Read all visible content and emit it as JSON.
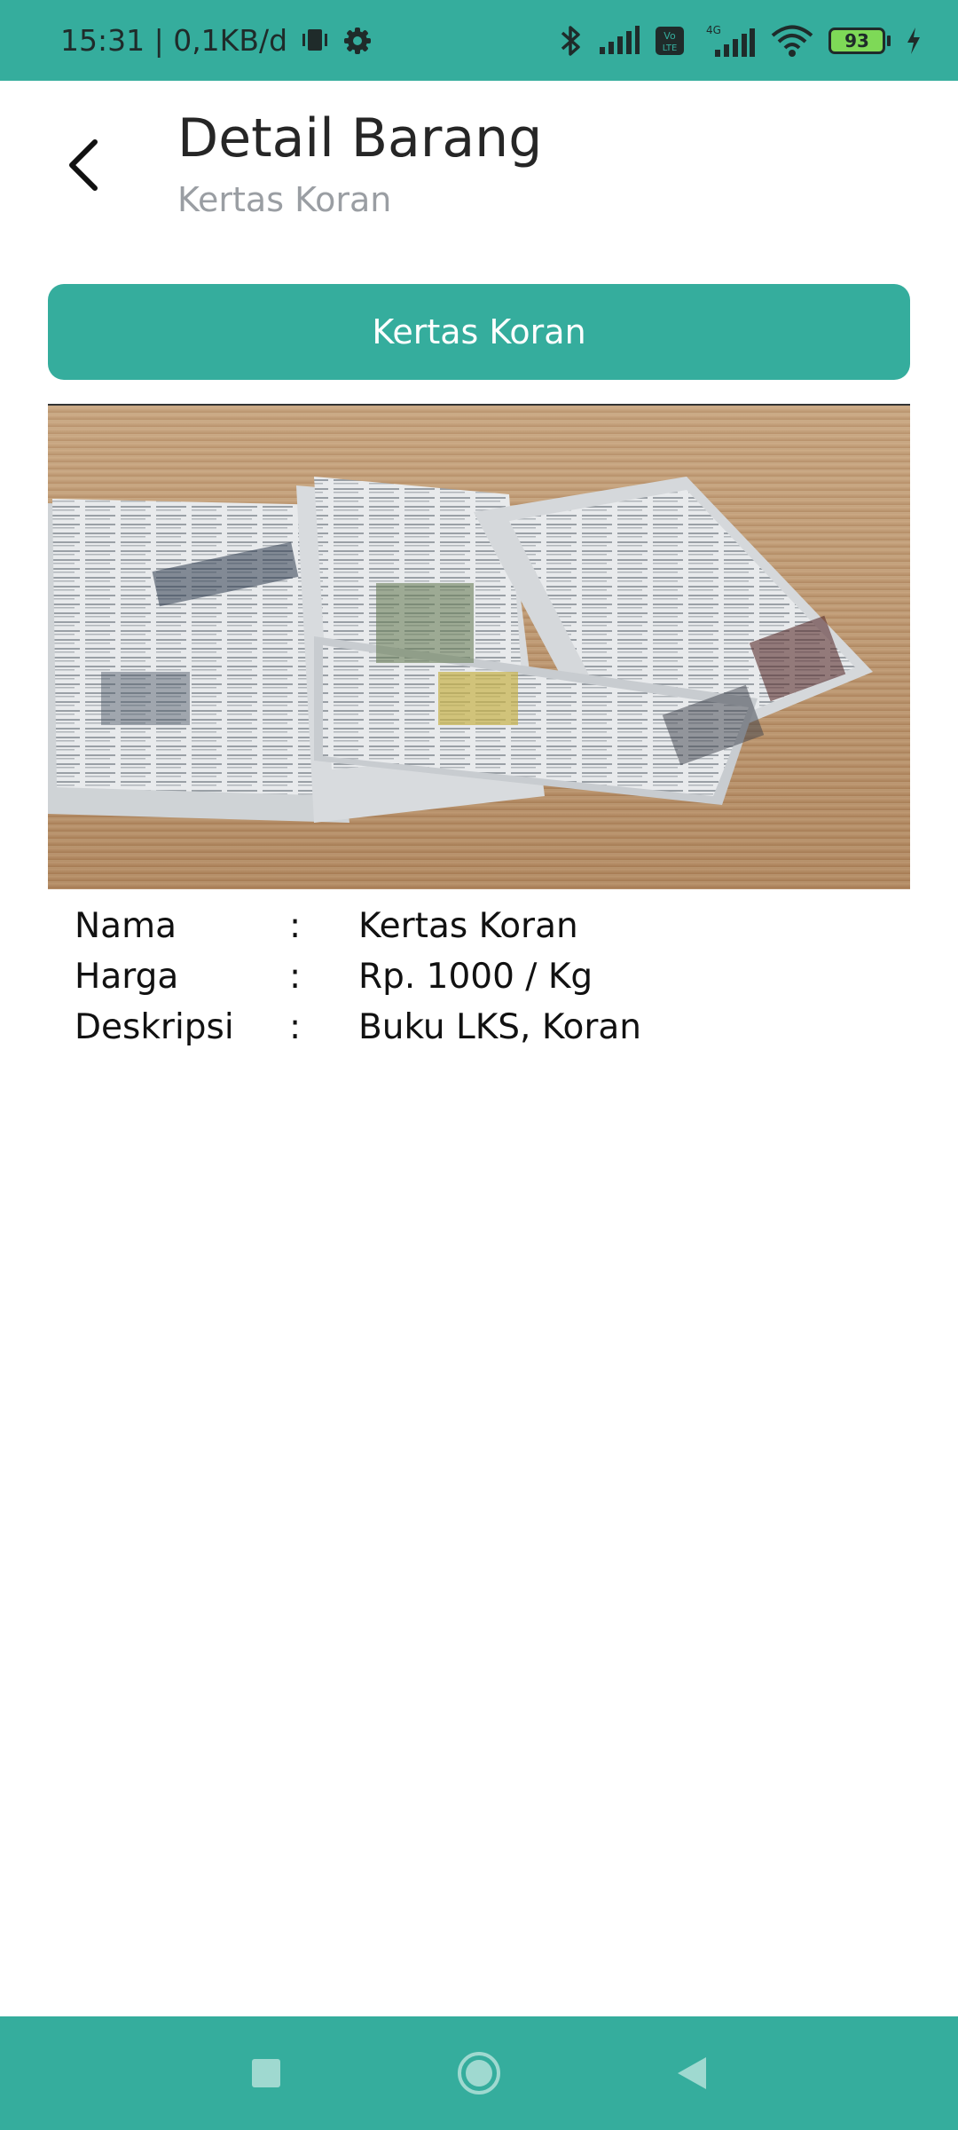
{
  "status_bar": {
    "time_speed": "15:31 | 0,1KB/d",
    "battery_level": "93",
    "icons": [
      "vibrate-icon",
      "settings-gear-icon",
      "bluetooth-icon",
      "signal-icon",
      "volte-icon",
      "4g-signal-icon",
      "wifi-icon",
      "battery-icon",
      "charging-icon"
    ]
  },
  "header": {
    "title": "Detail Barang",
    "subtitle": "Kertas Koran",
    "back_icon": "chevron-left-icon"
  },
  "category_button": {
    "label": "Kertas Koran"
  },
  "product": {
    "image_alt": "Tumpukan kertas koran di atas meja kayu",
    "rows": [
      {
        "label": "Nama",
        "separator": ":",
        "value": "Kertas Koran"
      },
      {
        "label": "Harga",
        "separator": ":",
        "value": "Rp. 1000 / Kg"
      },
      {
        "label": "Deskripsi",
        "separator": ":",
        "value": "Buku LKS, Koran"
      }
    ]
  },
  "nav_bar": {
    "buttons": [
      "recents-square-icon",
      "home-circle-icon",
      "back-triangle-icon"
    ]
  },
  "colors": {
    "accent": "#35ad9d",
    "title": "#262626",
    "subtitle": "#9a9ea3",
    "background": "#ffffff"
  }
}
